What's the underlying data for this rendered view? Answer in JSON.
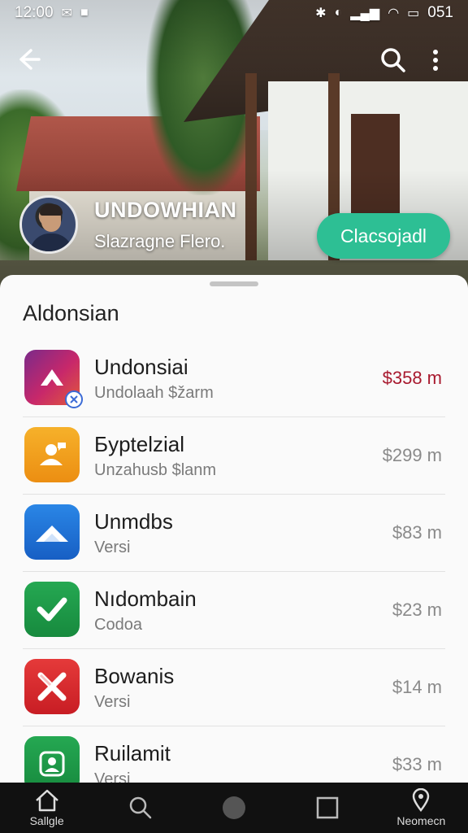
{
  "status_bar": {
    "time": "12:00",
    "battery": "051"
  },
  "profile": {
    "name": "UNDOWHIAN",
    "subtitle": "Slazragne Flero.",
    "cta_label": "Clacsojadl"
  },
  "sheet": {
    "title": "Aldonsian",
    "items": [
      {
        "title": "Undonsiai",
        "subtitle": "Undolaah $žarm",
        "price": "$358 m",
        "icon": "gradient-arrow-icon",
        "color": "#8a2a6a"
      },
      {
        "title": "Бyptelzial",
        "subtitle": "Unzahusb $lanm",
        "price": "$299 m",
        "icon": "chat-person-icon",
        "color": "#f2a21a"
      },
      {
        "title": "Unmdbs",
        "subtitle": "Versi",
        "price": "$83 m",
        "icon": "cloud-icon",
        "color": "#1f74d6"
      },
      {
        "title": "Nıdombain",
        "subtitle": "Codoa",
        "price": "$23 m",
        "icon": "check-icon",
        "color": "#1e9a48"
      },
      {
        "title": "Bowanis",
        "subtitle": "Versi",
        "price": "$14 m",
        "icon": "x-icon",
        "color": "#d8262c"
      },
      {
        "title": "Ruilamit",
        "subtitle": "Versi",
        "price": "$33 m",
        "icon": "user-icon",
        "color": "#1e9a48"
      }
    ]
  },
  "navbar": {
    "items": [
      {
        "label": "Sallgle",
        "icon": "home-icon"
      },
      {
        "label": "",
        "icon": "search-icon"
      },
      {
        "label": "",
        "icon": "circle-icon"
      },
      {
        "label": "",
        "icon": "square-icon"
      },
      {
        "label": "Neomecn",
        "icon": "location-icon"
      }
    ]
  },
  "colors": {
    "accent": "#2dbf94",
    "price_highlight": "#a8192e"
  }
}
